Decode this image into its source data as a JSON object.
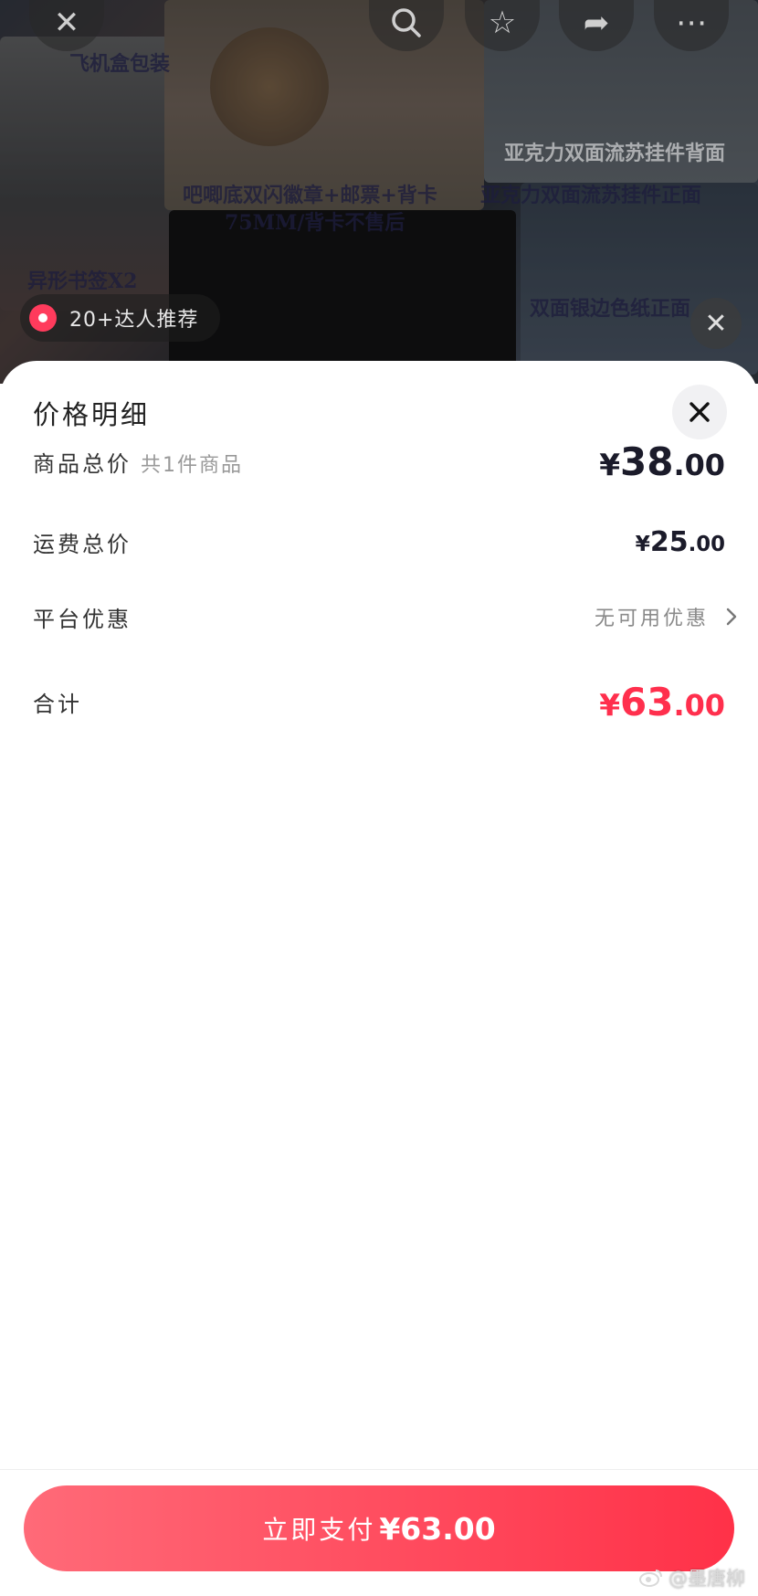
{
  "background": {
    "texts": [
      "飞机盒包装",
      "吧唧底双闪徽章+邮票+背卡",
      "75MM/背卡不售后",
      "亚克力双面流苏挂件背面",
      "亚克力双面流苏挂件正面",
      "异形书签X2",
      "双面银边色纸正面"
    ],
    "recommend_badge": "20+达人推荐",
    "top_icons": [
      "close-icon",
      "search-icon",
      "star-icon",
      "share-icon",
      "more-icon"
    ]
  },
  "sheet": {
    "title": "价格明细",
    "rows": {
      "goods": {
        "label": "商品总价",
        "sub": "共1件商品",
        "symbol": "¥",
        "int": "38",
        "dec": ".00"
      },
      "shipping": {
        "label": "运费总价",
        "symbol": "¥",
        "int": "25",
        "dec": ".00"
      },
      "platform": {
        "label": "平台优惠",
        "value": "无可用优惠"
      },
      "total": {
        "label": "合计",
        "symbol": "¥",
        "int": "63",
        "dec": ".00"
      }
    }
  },
  "pay_button": {
    "label": "立即支付",
    "amount": "¥63.00"
  },
  "watermark": "@墨唐柳",
  "colors": {
    "accent": "#ff2f4d",
    "button_start": "#ff6a78",
    "button_end": "#ff3148"
  }
}
